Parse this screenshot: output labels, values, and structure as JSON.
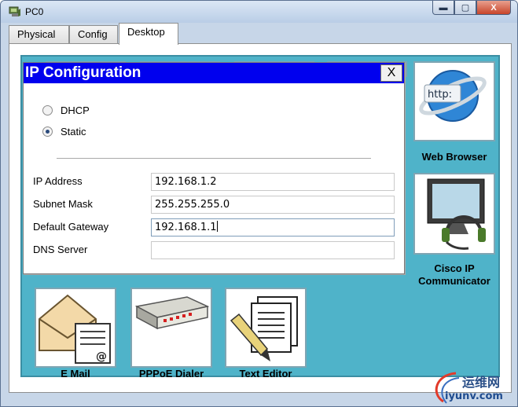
{
  "window": {
    "title": "PC0",
    "controls": {
      "minimize": "▬",
      "maximize": "▢",
      "close": "X"
    }
  },
  "tabs": [
    {
      "label": "Physical",
      "active": false
    },
    {
      "label": "Config",
      "active": false
    },
    {
      "label": "Desktop",
      "active": true
    }
  ],
  "desktop": {
    "background_color": "#4fb3c9",
    "apps": [
      {
        "label": "Web Browser",
        "icon": "web-browser-icon"
      },
      {
        "label": "Cisco IP Communicator",
        "icon": "ip-communicator-icon"
      },
      {
        "label": "E Mail",
        "icon": "email-icon"
      },
      {
        "label": "PPPoE Dialer",
        "icon": "pppoe-dialer-icon"
      },
      {
        "label": "Text Editor",
        "icon": "text-editor-icon"
      }
    ],
    "http_badge": "http:"
  },
  "ip_config": {
    "title": "IP Configuration",
    "close_label": "X",
    "title_color": "#0000ee",
    "mode": {
      "options": [
        "DHCP",
        "Static"
      ],
      "selected": "Static"
    },
    "fields": [
      {
        "label": "IP Address",
        "value": "192.168.1.2"
      },
      {
        "label": "Subnet Mask",
        "value": "255.255.255.0"
      },
      {
        "label": "Default Gateway",
        "value": "192.168.1.1"
      },
      {
        "label": "DNS Server",
        "value": ""
      }
    ]
  },
  "watermark": {
    "site_cn": "运维网",
    "url": "iyunv.com"
  }
}
